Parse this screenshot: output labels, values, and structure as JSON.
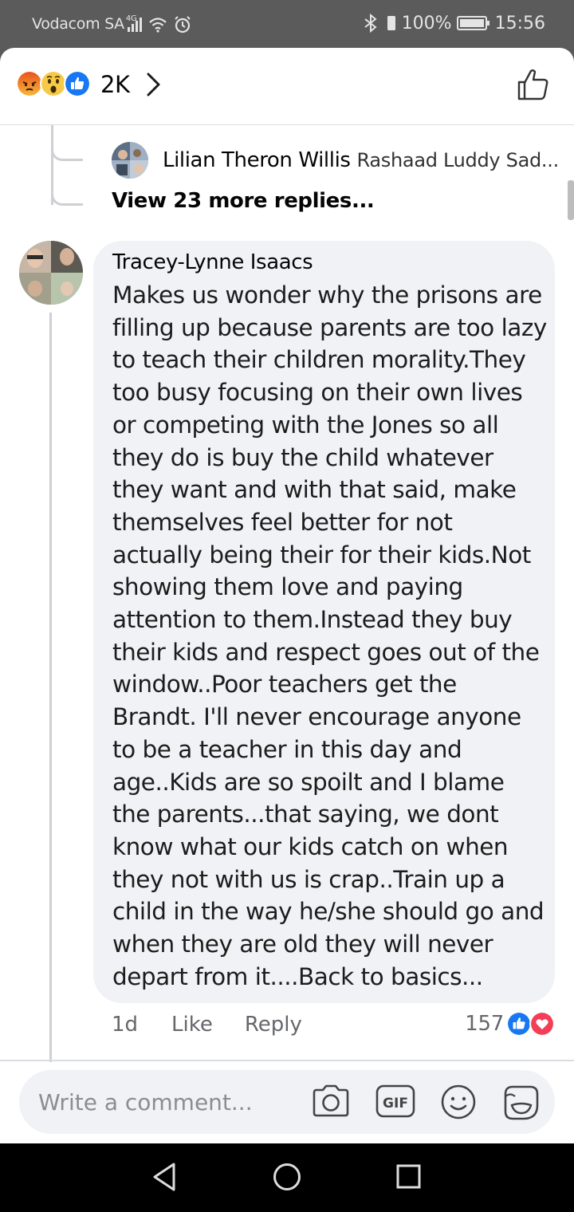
{
  "status_bar": {
    "carrier": "Vodacom SA",
    "network": "4G",
    "battery": "100%",
    "time": "15:56"
  },
  "reactions_header": {
    "emojis": [
      "angry-emoji",
      "wow-emoji",
      "like-emoji"
    ],
    "count": "2K"
  },
  "reply_preview": {
    "author": "Lilian Theron Willis",
    "snippet": "Rashaad Luddy Sad..."
  },
  "more_replies": "View 23 more replies...",
  "comment": {
    "author": "Tracey-Lynne Isaacs",
    "text": "Makes us wonder why the prisons are filling up because parents are too lazy to teach their children morality.They too busy focusing on their own lives or competing with the Jones so all they do is buy the child whatever they want and with that said, make themselves feel better for not actually being their for their kids.Not showing them love and paying attention to them.Instead they buy their kids and respect goes out of the window..Poor teachers get the Brandt. I'll never encourage anyone to be a teacher in this day and age..Kids are so spoilt and I blame the parents...that saying, we dont know what our kids catch on when they not with us is crap..Train up a child in the way he/she should go and when they are old they will never depart from it....Back to basics...",
    "time": "1d",
    "like_label": "Like",
    "reply_label": "Reply",
    "reaction_count": "157"
  },
  "composer": {
    "placeholder": "Write a comment..."
  },
  "colors": {
    "brand_blue": "#1877f2",
    "love_red": "#f33e58",
    "bubble_bg": "#f0f2f5",
    "muted_text": "#65676b"
  }
}
